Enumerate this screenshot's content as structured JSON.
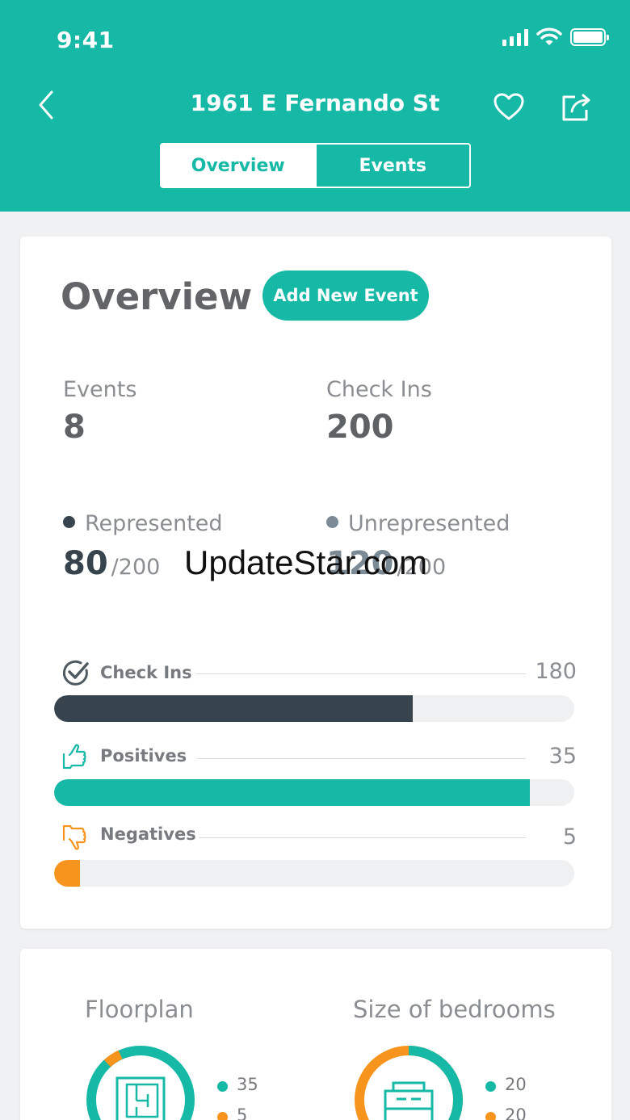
{
  "status_bar": {
    "time": "9:41"
  },
  "nav": {
    "title": "1961 E Fernando St"
  },
  "segments": {
    "overview": "Overview",
    "events": "Events"
  },
  "overview": {
    "title": "Overview",
    "add_button": "Add New Event",
    "events_label": "Events",
    "events_value": "8",
    "checkins_label": "Check Ins",
    "checkins_value": "200",
    "represented_label": "Represented",
    "represented_value": "80",
    "represented_total": "/200",
    "unrepresented_label": "Unrepresented",
    "unrepresented_value": "120",
    "unrepresented_total": "/200"
  },
  "bars": [
    {
      "label": "Check Ins",
      "value": "180",
      "fraction": 0.69,
      "color": "#37444d",
      "icon": "check-circle-icon"
    },
    {
      "label": "Positives",
      "value": "35",
      "fraction": 0.915,
      "color": "#16b8a6",
      "icon": "thumbs-up-icon"
    },
    {
      "label": "Negatives",
      "value": "5",
      "fraction": 0.05,
      "color": "#f7941d",
      "icon": "thumbs-down-icon"
    }
  ],
  "watermark": "UpdateStar.com",
  "breakdown": {
    "floorplan_label": "Floorplan",
    "floorplan_legend": [
      "35",
      "5"
    ],
    "bedrooms_label": "Size of bedrooms",
    "bedrooms_legend": [
      "20",
      "20"
    ]
  },
  "colors": {
    "accent": "#16b8a6",
    "dark": "#37444d",
    "orange": "#f7941d",
    "gray_dot": "#7b8a95"
  }
}
